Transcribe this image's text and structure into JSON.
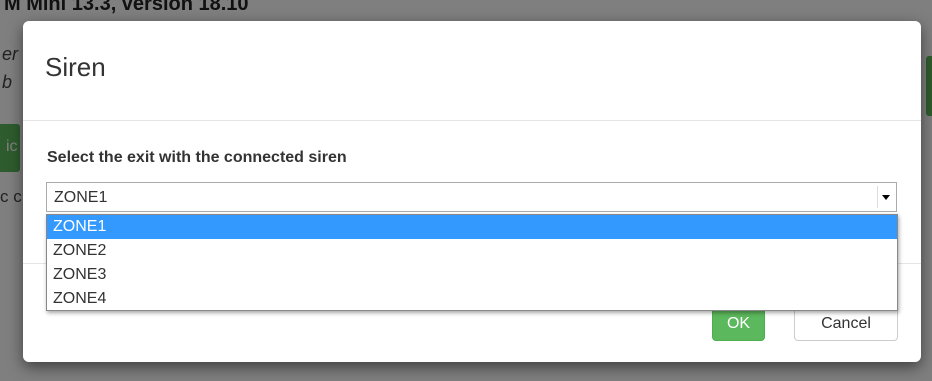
{
  "background": {
    "title_fragment": "M Mini 13.3, version 18.10",
    "line1_fragment": "er",
    "line2_fragment": "b",
    "green_button_fragment": "ic",
    "text_fragment": "c c"
  },
  "modal": {
    "title": "Siren",
    "field_label": "Select the exit with the connected siren",
    "select": {
      "selected_value": "ZONE1",
      "options": [
        {
          "label": "ZONE1",
          "highlighted": true
        },
        {
          "label": "ZONE2",
          "highlighted": false
        },
        {
          "label": "ZONE3",
          "highlighted": false
        },
        {
          "label": "ZONE4",
          "highlighted": false
        }
      ]
    },
    "footer": {
      "ok_label": "OK",
      "cancel_label": "Cancel"
    }
  },
  "colors": {
    "primary_green": "#5cb85c",
    "highlight_blue": "#3399ff",
    "backdrop": "#000000"
  }
}
